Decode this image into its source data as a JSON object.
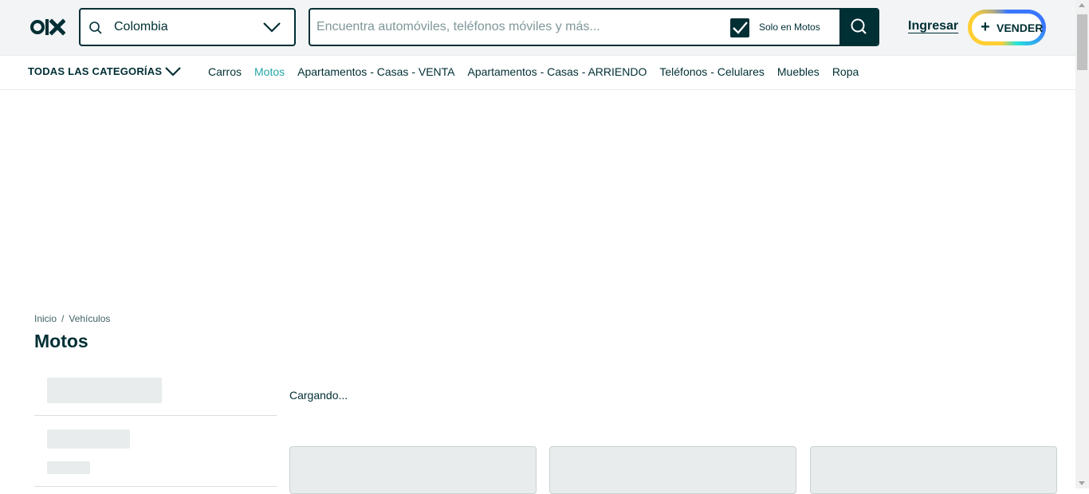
{
  "header": {
    "logo_icon": "olx-logo-icon",
    "location": {
      "value": "Colombia",
      "icon": "search-icon",
      "dropdown_icon": "chevron-down-icon"
    },
    "search": {
      "placeholder": "Encuentra automóviles, teléfonos móviles y más...",
      "checkbox_label": "Solo en Motos",
      "checkbox_checked": true,
      "button_icon": "search-icon"
    },
    "login_label": "Ingresar",
    "sell": {
      "plus": "+",
      "label": "VENDER"
    }
  },
  "categories": {
    "all_label": "TODAS LAS CATEGORÍAS",
    "items": [
      {
        "label": "Carros",
        "active": false
      },
      {
        "label": "Motos",
        "active": true
      },
      {
        "label": "Apartamentos - Casas - VENTA",
        "active": false
      },
      {
        "label": "Apartamentos - Casas - ARRIENDO",
        "active": false
      },
      {
        "label": "Teléfonos - Celulares",
        "active": false
      },
      {
        "label": "Muebles",
        "active": false
      },
      {
        "label": "Ropa",
        "active": false
      }
    ]
  },
  "breadcrumb": {
    "items": [
      "Inicio",
      "Vehículos"
    ],
    "separator": "/"
  },
  "page_title": "Motos",
  "status_text": "Cargando...",
  "colors": {
    "brand": "#002f34",
    "accent": "#23a6a6",
    "skeleton": "#e8ecec",
    "background": "#f2f4f5"
  }
}
